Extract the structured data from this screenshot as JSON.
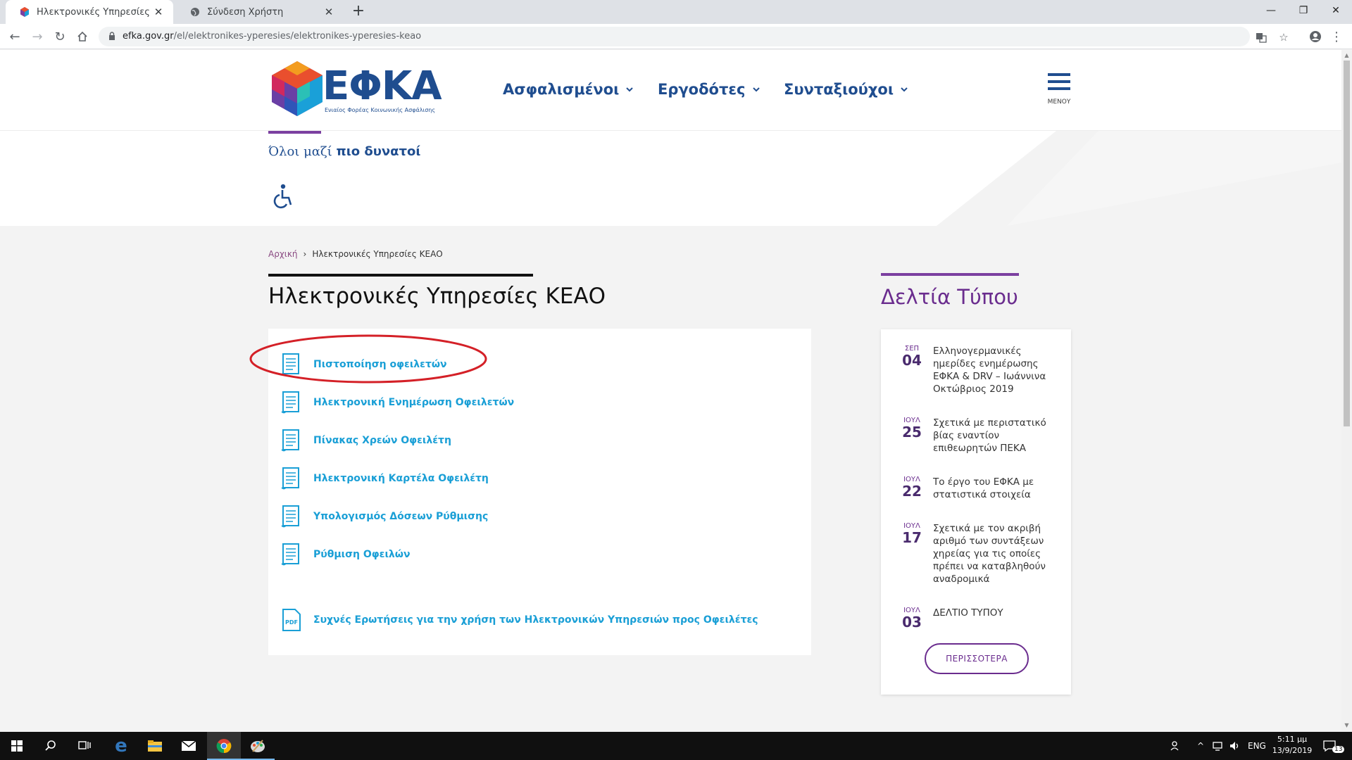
{
  "browser": {
    "tabs": [
      {
        "title": "Ηλεκτρονικές Υπηρεσίες ΚΕΑΟ |",
        "active": true
      },
      {
        "title": "Σύνδεση Χρήστη",
        "active": false
      }
    ],
    "url_host": "efka.gov.gr",
    "url_path": "/el/elektronikes-yperesies/elektronikes-yperesies-keao"
  },
  "header": {
    "logo_text": "ΕΦΚΑ",
    "logo_subtitle": "Ενιαίος Φορέας Κοινωνικής Ασφάλισης",
    "nav": [
      "Ασφαλισμένοι",
      "Εργοδότες",
      "Συνταξιούχοι"
    ],
    "menu_label": "ΜΕΝΟΥ",
    "tagline_regular": "Όλοι μαζί ",
    "tagline_bold": "πιο δυνατοί"
  },
  "breadcrumb": {
    "home": "Αρχική",
    "current": "Ηλεκτρονικές Υπηρεσίες ΚΕΑΟ"
  },
  "main": {
    "title": "Ηλεκτρονικές Υπηρεσίες ΚΕΑΟ",
    "services": [
      "Πιστοποίηση οφειλετών",
      "Ηλεκτρονική Ενημέρωση Οφειλετών",
      "Πίνακας Χρεών Οφειλέτη",
      "Ηλεκτρονική Καρτέλα Οφειλέτη",
      "Υπολογισμός Δόσεων Ρύθμισης",
      "Ρύθμιση Οφειλών"
    ],
    "faq": "Συχνές Ερωτήσεις για την χρήση των Ηλεκτρονικών Υπηρεσιών προς Οφειλέτες",
    "pdf_label": "PDF"
  },
  "press": {
    "title": "Δελτία Τύπου",
    "items": [
      {
        "month": "ΣΕΠ",
        "day": "04",
        "text": "Ελληνογερμανικές ημερίδες ενημέρωσης ΕΦΚΑ & DRV – Ιωάννινα Οκτώβριος 2019"
      },
      {
        "month": "ΙΟΥΛ",
        "day": "25",
        "text": "Σχετικά με περιστατικό βίας εναντίον επιθεωρητών ΠΕΚΑ"
      },
      {
        "month": "ΙΟΥΛ",
        "day": "22",
        "text": "Το έργο του ΕΦΚΑ με στατιστικά στοιχεία"
      },
      {
        "month": "ΙΟΥΛ",
        "day": "17",
        "text": "Σχετικά με τον ακριβή αριθμό των συντάξεων χηρείας για τις οποίες πρέπει να καταβληθούν αναδρομικά"
      },
      {
        "month": "ΙΟΥΛ",
        "day": "03",
        "text": "ΔΕΛΤΙΟ ΤΥΠΟΥ"
      }
    ],
    "more": "ΠΕΡΙΣΣΟΤΕΡΑ"
  },
  "taskbar": {
    "lang": "ENG",
    "time": "5:11 μμ",
    "date": "13/9/2019",
    "notifications": "13"
  },
  "colors": {
    "brand_blue": "#1f4d8f",
    "link_cyan": "#1a9fd6",
    "purple": "#6a2c8e",
    "highlight_red": "#d42027"
  }
}
